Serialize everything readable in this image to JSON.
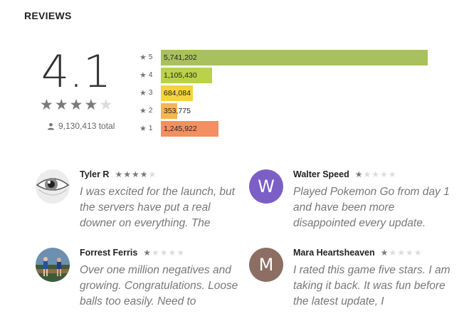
{
  "section": {
    "title": "REVIEWS"
  },
  "summary": {
    "score": "4.1",
    "rating_stars": 4,
    "total": "9,130,413 total"
  },
  "histogram": [
    {
      "star": "5",
      "count": "5,741,202",
      "fraction": 1.0,
      "color": "#a8c15c"
    },
    {
      "star": "4",
      "count": "1,105,430",
      "fraction": 0.193,
      "color": "#b9d24a"
    },
    {
      "star": "3",
      "count": "684,084",
      "fraction": 0.119,
      "color": "#f4d33e"
    },
    {
      "star": "2",
      "count": "353,775",
      "fraction": 0.062,
      "color": "#f7b54d"
    },
    {
      "star": "1",
      "count": "1,245,922",
      "fraction": 0.217,
      "color": "#f29062"
    }
  ],
  "reviews": [
    {
      "name": "Tyler R",
      "stars": 4,
      "avatar": "eye-photo",
      "text": "I was excited for the launch, but the servers have put a real downer on everything. The"
    },
    {
      "name": "Walter Speed",
      "stars": 1,
      "avatar_letter": "W",
      "avatar_color": "#7b5fc7",
      "text": "Played Pokemon Go from day 1 and have been more disappointed every update."
    },
    {
      "name": "Forrest Ferris",
      "stars": 1,
      "avatar": "runners-photo",
      "text": "Over one million negatives and growing. Congratulations. Loose balls too easily. Need to"
    },
    {
      "name": "Mara Heartsheaven",
      "stars": 1,
      "avatar_letter": "M",
      "avatar_color": "#8d6e63",
      "text": "I rated this game five stars. I am taking it back. It was fun before the latest update, I"
    }
  ]
}
